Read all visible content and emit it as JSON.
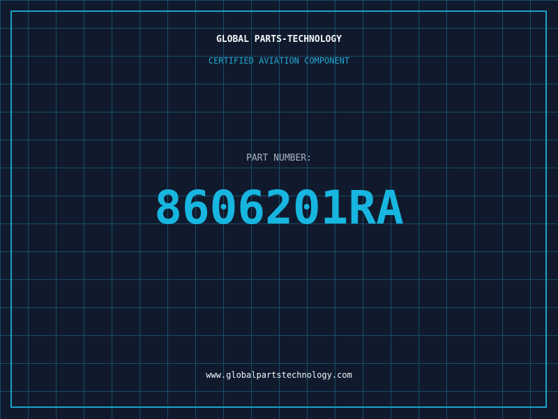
{
  "header": {
    "brand": "GLOBAL PARTS-TECHNOLOGY",
    "subtitle": "CERTIFIED AVIATION COMPONENT"
  },
  "part": {
    "label": "PART NUMBER:",
    "number": "8606201RA"
  },
  "footer": {
    "url": "www.globalpartstechnology.com"
  },
  "colors": {
    "background": "#111a2d",
    "grid": "#1a96b4",
    "accent": "#17b6e0",
    "text": "#f2f5f8",
    "muted": "#a9b4c2"
  }
}
